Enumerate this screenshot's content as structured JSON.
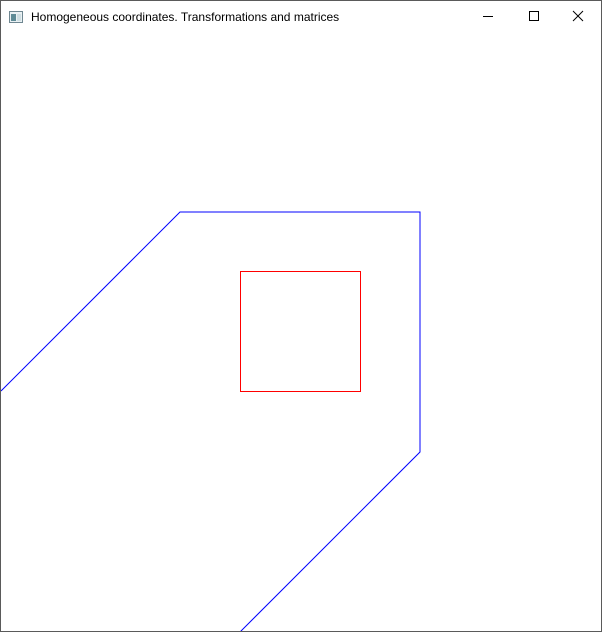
{
  "window": {
    "title": "Homogeneous coordinates. Transformations and matrices",
    "icon": "app-window-icon",
    "controls": [
      "minimize-icon",
      "maximize-icon",
      "close-icon"
    ]
  },
  "canvas": {
    "background": "#ffffff",
    "shapes": [
      {
        "name": "octagon-shape",
        "color": "#0000ff"
      },
      {
        "name": "square-shape",
        "color": "#ff0000"
      }
    ]
  }
}
